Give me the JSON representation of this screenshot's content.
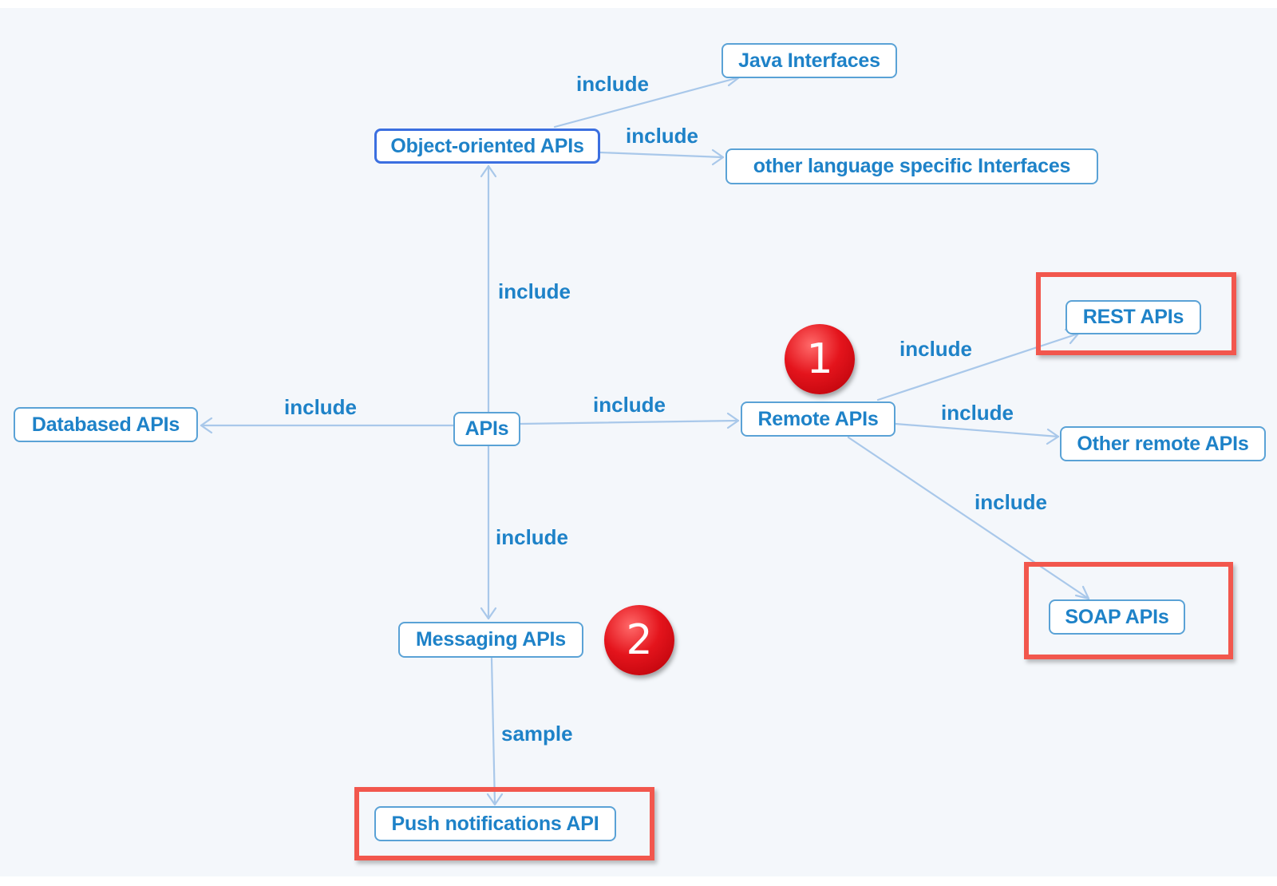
{
  "nodes": {
    "java_interfaces": "Java Interfaces",
    "object_oriented_apis": "Object-oriented APIs",
    "other_language_interfaces": "other language specific Interfaces",
    "rest_apis": "REST APIs",
    "databased_apis": "Databased APIs",
    "apis": "APIs",
    "remote_apis": "Remote APIs",
    "other_remote_apis": "Other remote APIs",
    "soap_apis": "SOAP APIs",
    "messaging_apis": "Messaging APIs",
    "push_notifications_api": "Push notifications API"
  },
  "edge_labels": {
    "oo_to_java": "include",
    "oo_to_other_lang": "include",
    "apis_to_oo": "include",
    "apis_to_databased": "include",
    "apis_to_remote": "include",
    "remote_to_rest": "include",
    "remote_to_other_remote": "include",
    "remote_to_soap": "include",
    "apis_to_messaging": "include",
    "messaging_to_push": "sample"
  },
  "badges": {
    "badge_1": "1",
    "badge_2": "2"
  },
  "colors": {
    "node_text": "#1e82c8",
    "node_border": "#5aa2d6",
    "edge_line": "#a9c8ea",
    "highlight_box": "#f2574d",
    "badge": "#e4141c"
  }
}
